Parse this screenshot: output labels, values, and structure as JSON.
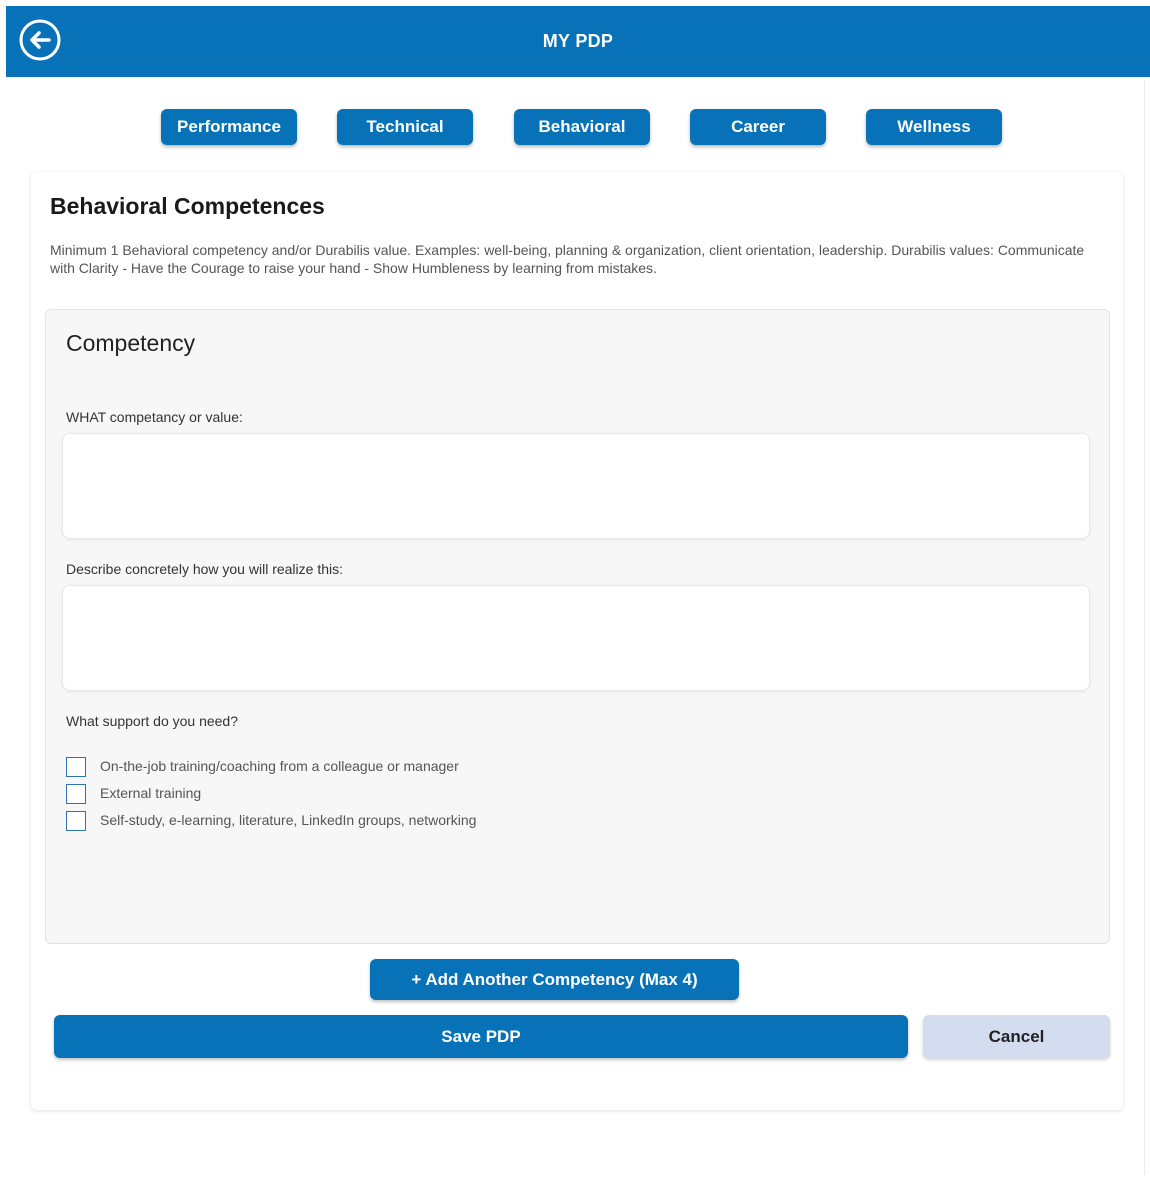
{
  "header": {
    "title": "MY PDP",
    "back_icon": "arrow-left-circle-icon"
  },
  "tabs": [
    {
      "label": "Performance"
    },
    {
      "label": "Technical"
    },
    {
      "label": "Behavioral"
    },
    {
      "label": "Career"
    },
    {
      "label": "Wellness"
    }
  ],
  "section": {
    "title": "Behavioral Competences",
    "description": "Minimum 1 Behavioral competency and/or Durabilis value. Examples: well-being, planning & organization, client orientation, leadership. Durabilis values: Communicate with Clarity - Have the Courage to raise your hand - Show Humbleness by learning from mistakes."
  },
  "competency": {
    "title": "Competency",
    "what_label": "WHAT competancy or value:",
    "what_value": "",
    "how_label": "Describe concretely how you will realize this:",
    "how_value": "",
    "support_label": "What support do you need?",
    "support_options": [
      {
        "label": "On-the-job training/coaching from a colleague or manager",
        "checked": false
      },
      {
        "label": "External training",
        "checked": false
      },
      {
        "label": "Self-study, e-learning, literature, LinkedIn groups, networking",
        "checked": false
      }
    ]
  },
  "actions": {
    "add_label": "+ Add Another Competency (Max 4)",
    "save_label": "Save PDP",
    "cancel_label": "Cancel"
  },
  "colors": {
    "primary": "#0772b8",
    "cancel_bg": "#d3ddef",
    "panel_bg": "#f7f7f7"
  }
}
